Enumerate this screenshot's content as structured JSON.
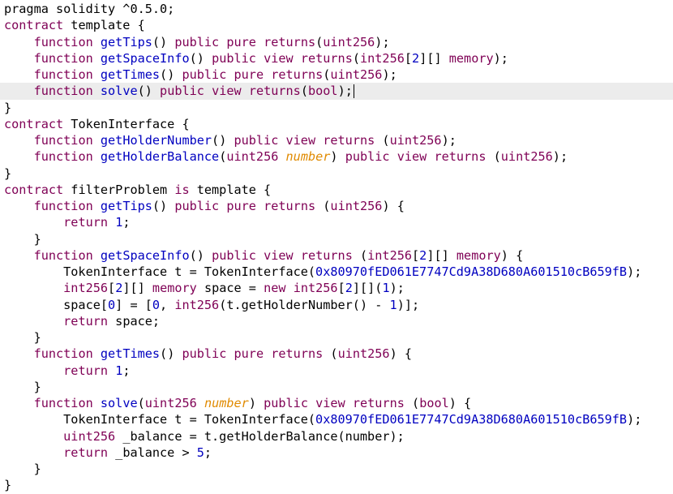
{
  "editor": {
    "current_line": 5,
    "lines": [
      [
        {
          "t": "pragma solidity ^0.5.0;",
          "c": "plain"
        }
      ],
      [
        {
          "t": "contract",
          "c": "kw"
        },
        {
          "t": " template {",
          "c": "plain"
        }
      ],
      [
        {
          "t": "    ",
          "c": "plain"
        },
        {
          "t": "function",
          "c": "kw"
        },
        {
          "t": " ",
          "c": "plain"
        },
        {
          "t": "getTips",
          "c": "fn"
        },
        {
          "t": "() ",
          "c": "plain"
        },
        {
          "t": "public",
          "c": "kw"
        },
        {
          "t": " ",
          "c": "plain"
        },
        {
          "t": "pure",
          "c": "kw"
        },
        {
          "t": " ",
          "c": "plain"
        },
        {
          "t": "returns",
          "c": "kw"
        },
        {
          "t": "(",
          "c": "plain"
        },
        {
          "t": "uint256",
          "c": "kw"
        },
        {
          "t": ");",
          "c": "plain"
        }
      ],
      [
        {
          "t": "    ",
          "c": "plain"
        },
        {
          "t": "function",
          "c": "kw"
        },
        {
          "t": " ",
          "c": "plain"
        },
        {
          "t": "getSpaceInfo",
          "c": "fn"
        },
        {
          "t": "() ",
          "c": "plain"
        },
        {
          "t": "public",
          "c": "kw"
        },
        {
          "t": " ",
          "c": "plain"
        },
        {
          "t": "view",
          "c": "kw"
        },
        {
          "t": " ",
          "c": "plain"
        },
        {
          "t": "returns",
          "c": "kw"
        },
        {
          "t": "(",
          "c": "plain"
        },
        {
          "t": "int256",
          "c": "kw"
        },
        {
          "t": "[",
          "c": "plain"
        },
        {
          "t": "2",
          "c": "num"
        },
        {
          "t": "][] ",
          "c": "plain"
        },
        {
          "t": "memory",
          "c": "kw"
        },
        {
          "t": ");",
          "c": "plain"
        }
      ],
      [
        {
          "t": "    ",
          "c": "plain"
        },
        {
          "t": "function",
          "c": "kw"
        },
        {
          "t": " ",
          "c": "plain"
        },
        {
          "t": "getTimes",
          "c": "fn"
        },
        {
          "t": "() ",
          "c": "plain"
        },
        {
          "t": "public",
          "c": "kw"
        },
        {
          "t": " ",
          "c": "plain"
        },
        {
          "t": "pure",
          "c": "kw"
        },
        {
          "t": " ",
          "c": "plain"
        },
        {
          "t": "returns",
          "c": "kw"
        },
        {
          "t": "(",
          "c": "plain"
        },
        {
          "t": "uint256",
          "c": "kw"
        },
        {
          "t": ");",
          "c": "plain"
        }
      ],
      [
        {
          "t": "    ",
          "c": "plain"
        },
        {
          "t": "function",
          "c": "kw"
        },
        {
          "t": " ",
          "c": "plain"
        },
        {
          "t": "solve",
          "c": "fn"
        },
        {
          "t": "() ",
          "c": "plain"
        },
        {
          "t": "public",
          "c": "kw"
        },
        {
          "t": " ",
          "c": "plain"
        },
        {
          "t": "view",
          "c": "kw"
        },
        {
          "t": " ",
          "c": "plain"
        },
        {
          "t": "returns",
          "c": "kw"
        },
        {
          "t": "(",
          "c": "plain"
        },
        {
          "t": "bool",
          "c": "kw"
        },
        {
          "t": ");",
          "c": "plain"
        }
      ],
      [
        {
          "t": "}",
          "c": "plain"
        }
      ],
      [
        {
          "t": "contract",
          "c": "kw"
        },
        {
          "t": " TokenInterface {",
          "c": "plain"
        }
      ],
      [
        {
          "t": "    ",
          "c": "plain"
        },
        {
          "t": "function",
          "c": "kw"
        },
        {
          "t": " ",
          "c": "plain"
        },
        {
          "t": "getHolderNumber",
          "c": "fn"
        },
        {
          "t": "() ",
          "c": "plain"
        },
        {
          "t": "public",
          "c": "kw"
        },
        {
          "t": " ",
          "c": "plain"
        },
        {
          "t": "view",
          "c": "kw"
        },
        {
          "t": " ",
          "c": "plain"
        },
        {
          "t": "returns",
          "c": "kw"
        },
        {
          "t": " (",
          "c": "plain"
        },
        {
          "t": "uint256",
          "c": "kw"
        },
        {
          "t": ");",
          "c": "plain"
        }
      ],
      [
        {
          "t": "    ",
          "c": "plain"
        },
        {
          "t": "function",
          "c": "kw"
        },
        {
          "t": " ",
          "c": "plain"
        },
        {
          "t": "getHolderBalance",
          "c": "fn"
        },
        {
          "t": "(",
          "c": "plain"
        },
        {
          "t": "uint256",
          "c": "kw"
        },
        {
          "t": " ",
          "c": "plain"
        },
        {
          "t": "number",
          "c": "param"
        },
        {
          "t": ") ",
          "c": "plain"
        },
        {
          "t": "public",
          "c": "kw"
        },
        {
          "t": " ",
          "c": "plain"
        },
        {
          "t": "view",
          "c": "kw"
        },
        {
          "t": " ",
          "c": "plain"
        },
        {
          "t": "returns",
          "c": "kw"
        },
        {
          "t": " (",
          "c": "plain"
        },
        {
          "t": "uint256",
          "c": "kw"
        },
        {
          "t": ");",
          "c": "plain"
        }
      ],
      [
        {
          "t": "}",
          "c": "plain"
        }
      ],
      [
        {
          "t": "contract",
          "c": "kw"
        },
        {
          "t": " filterProblem ",
          "c": "plain"
        },
        {
          "t": "is",
          "c": "kw"
        },
        {
          "t": " template {",
          "c": "plain"
        }
      ],
      [
        {
          "t": "    ",
          "c": "plain"
        },
        {
          "t": "function",
          "c": "kw"
        },
        {
          "t": " ",
          "c": "plain"
        },
        {
          "t": "getTips",
          "c": "fn"
        },
        {
          "t": "() ",
          "c": "plain"
        },
        {
          "t": "public",
          "c": "kw"
        },
        {
          "t": " ",
          "c": "plain"
        },
        {
          "t": "pure",
          "c": "kw"
        },
        {
          "t": " ",
          "c": "plain"
        },
        {
          "t": "returns",
          "c": "kw"
        },
        {
          "t": " (",
          "c": "plain"
        },
        {
          "t": "uint256",
          "c": "kw"
        },
        {
          "t": ") {",
          "c": "plain"
        }
      ],
      [
        {
          "t": "        ",
          "c": "plain"
        },
        {
          "t": "return",
          "c": "kw"
        },
        {
          "t": " ",
          "c": "plain"
        },
        {
          "t": "1",
          "c": "num"
        },
        {
          "t": ";",
          "c": "plain"
        }
      ],
      [
        {
          "t": "    }",
          "c": "plain"
        }
      ],
      [
        {
          "t": "    ",
          "c": "plain"
        },
        {
          "t": "function",
          "c": "kw"
        },
        {
          "t": " ",
          "c": "plain"
        },
        {
          "t": "getSpaceInfo",
          "c": "fn"
        },
        {
          "t": "() ",
          "c": "plain"
        },
        {
          "t": "public",
          "c": "kw"
        },
        {
          "t": " ",
          "c": "plain"
        },
        {
          "t": "view",
          "c": "kw"
        },
        {
          "t": " ",
          "c": "plain"
        },
        {
          "t": "returns",
          "c": "kw"
        },
        {
          "t": " (",
          "c": "plain"
        },
        {
          "t": "int256",
          "c": "kw"
        },
        {
          "t": "[",
          "c": "plain"
        },
        {
          "t": "2",
          "c": "num"
        },
        {
          "t": "][] ",
          "c": "plain"
        },
        {
          "t": "memory",
          "c": "kw"
        },
        {
          "t": ") {",
          "c": "plain"
        }
      ],
      [
        {
          "t": "        TokenInterface t = TokenInterface(",
          "c": "plain"
        },
        {
          "t": "0x80970fED061E7747Cd9A38D680A601510cB659fB",
          "c": "num"
        },
        {
          "t": ");",
          "c": "plain"
        }
      ],
      [
        {
          "t": "        ",
          "c": "plain"
        },
        {
          "t": "int256",
          "c": "kw"
        },
        {
          "t": "[",
          "c": "plain"
        },
        {
          "t": "2",
          "c": "num"
        },
        {
          "t": "][] ",
          "c": "plain"
        },
        {
          "t": "memory",
          "c": "kw"
        },
        {
          "t": " space = ",
          "c": "plain"
        },
        {
          "t": "new",
          "c": "kw"
        },
        {
          "t": " ",
          "c": "plain"
        },
        {
          "t": "int256",
          "c": "kw"
        },
        {
          "t": "[",
          "c": "plain"
        },
        {
          "t": "2",
          "c": "num"
        },
        {
          "t": "][](",
          "c": "plain"
        },
        {
          "t": "1",
          "c": "num"
        },
        {
          "t": ");",
          "c": "plain"
        }
      ],
      [
        {
          "t": "        space[",
          "c": "plain"
        },
        {
          "t": "0",
          "c": "num"
        },
        {
          "t": "] = [",
          "c": "plain"
        },
        {
          "t": "0",
          "c": "num"
        },
        {
          "t": ", ",
          "c": "plain"
        },
        {
          "t": "int256",
          "c": "kw"
        },
        {
          "t": "(t.getHolderNumber() - ",
          "c": "plain"
        },
        {
          "t": "1",
          "c": "num"
        },
        {
          "t": ")];",
          "c": "plain"
        }
      ],
      [
        {
          "t": "        ",
          "c": "plain"
        },
        {
          "t": "return",
          "c": "kw"
        },
        {
          "t": " space;",
          "c": "plain"
        }
      ],
      [
        {
          "t": "    }",
          "c": "plain"
        }
      ],
      [
        {
          "t": "    ",
          "c": "plain"
        },
        {
          "t": "function",
          "c": "kw"
        },
        {
          "t": " ",
          "c": "plain"
        },
        {
          "t": "getTimes",
          "c": "fn"
        },
        {
          "t": "() ",
          "c": "plain"
        },
        {
          "t": "public",
          "c": "kw"
        },
        {
          "t": " ",
          "c": "plain"
        },
        {
          "t": "pure",
          "c": "kw"
        },
        {
          "t": " ",
          "c": "plain"
        },
        {
          "t": "returns",
          "c": "kw"
        },
        {
          "t": " (",
          "c": "plain"
        },
        {
          "t": "uint256",
          "c": "kw"
        },
        {
          "t": ") {",
          "c": "plain"
        }
      ],
      [
        {
          "t": "        ",
          "c": "plain"
        },
        {
          "t": "return",
          "c": "kw"
        },
        {
          "t": " ",
          "c": "plain"
        },
        {
          "t": "1",
          "c": "num"
        },
        {
          "t": ";",
          "c": "plain"
        }
      ],
      [
        {
          "t": "    }",
          "c": "plain"
        }
      ],
      [
        {
          "t": "    ",
          "c": "plain"
        },
        {
          "t": "function",
          "c": "kw"
        },
        {
          "t": " ",
          "c": "plain"
        },
        {
          "t": "solve",
          "c": "fn"
        },
        {
          "t": "(",
          "c": "plain"
        },
        {
          "t": "uint256",
          "c": "kw"
        },
        {
          "t": " ",
          "c": "plain"
        },
        {
          "t": "number",
          "c": "param"
        },
        {
          "t": ") ",
          "c": "plain"
        },
        {
          "t": "public",
          "c": "kw"
        },
        {
          "t": " ",
          "c": "plain"
        },
        {
          "t": "view",
          "c": "kw"
        },
        {
          "t": " ",
          "c": "plain"
        },
        {
          "t": "returns",
          "c": "kw"
        },
        {
          "t": " (",
          "c": "plain"
        },
        {
          "t": "bool",
          "c": "kw"
        },
        {
          "t": ") {",
          "c": "plain"
        }
      ],
      [
        {
          "t": "        TokenInterface t = TokenInterface(",
          "c": "plain"
        },
        {
          "t": "0x80970fED061E7747Cd9A38D680A601510cB659fB",
          "c": "num"
        },
        {
          "t": ");",
          "c": "plain"
        }
      ],
      [
        {
          "t": "        ",
          "c": "plain"
        },
        {
          "t": "uint256",
          "c": "kw"
        },
        {
          "t": " _balance = t.getHolderBalance(number);",
          "c": "plain"
        }
      ],
      [
        {
          "t": "        ",
          "c": "plain"
        },
        {
          "t": "return",
          "c": "kw"
        },
        {
          "t": " _balance > ",
          "c": "plain"
        },
        {
          "t": "5",
          "c": "num"
        },
        {
          "t": ";",
          "c": "plain"
        }
      ],
      [
        {
          "t": "    }",
          "c": "plain"
        }
      ],
      [
        {
          "t": "}",
          "c": "plain"
        }
      ]
    ]
  }
}
